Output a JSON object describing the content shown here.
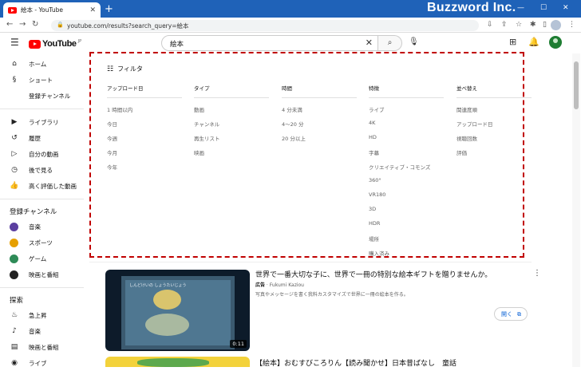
{
  "browser": {
    "tab_title": "絵本 - YouTube",
    "new_tab": "+",
    "brand": "Buzzword Inc.",
    "url": "youtube.com/results?search_query=絵本"
  },
  "header": {
    "logo_text": "YouTube",
    "logo_jp": "JP",
    "search_value": "絵本"
  },
  "sidebar": {
    "main": [
      {
        "label": "ホーム",
        "icon": "home-icon",
        "glyph": "⌂"
      },
      {
        "label": "ショート",
        "icon": "shorts-icon",
        "glyph": "§"
      },
      {
        "label": "登録チャンネル",
        "icon": "subscriptions-icon",
        "glyph": ""
      }
    ],
    "library": [
      {
        "label": "ライブラリ",
        "icon": "library-icon",
        "glyph": "▶"
      },
      {
        "label": "履歴",
        "icon": "history-icon",
        "glyph": "↺"
      },
      {
        "label": "自分の動画",
        "icon": "your-videos-icon",
        "glyph": "▷"
      },
      {
        "label": "後で見る",
        "icon": "watch-later-icon",
        "glyph": "◷"
      },
      {
        "label": "高く評価した動画",
        "icon": "liked-icon",
        "glyph": "👍"
      }
    ],
    "subscriptions_heading": "登録チャンネル",
    "channels": [
      {
        "label": "音楽",
        "color": "#5b3fa0"
      },
      {
        "label": "スポーツ",
        "color": "#e6a000"
      },
      {
        "label": "ゲーム",
        "color": "#2e8b57"
      },
      {
        "label": "映画と番組",
        "color": "#222222"
      }
    ],
    "explore_heading": "探索",
    "explore": [
      {
        "label": "急上昇",
        "icon": "trending-icon",
        "glyph": "♨"
      },
      {
        "label": "音楽",
        "icon": "music-icon",
        "glyph": "♪"
      },
      {
        "label": "映画と番組",
        "icon": "movies-icon",
        "glyph": "▤"
      },
      {
        "label": "ライブ",
        "icon": "live-icon",
        "glyph": "◉"
      }
    ]
  },
  "filter": {
    "title": "フィルタ",
    "columns": [
      {
        "heading": "アップロード日",
        "options": [
          "1 時間以内",
          "今日",
          "今週",
          "今月",
          "今年"
        ]
      },
      {
        "heading": "タイプ",
        "options": [
          "動画",
          "チャンネル",
          "再生リスト",
          "映画"
        ]
      },
      {
        "heading": "時間",
        "options": [
          "4 分未満",
          "4～20 分",
          "20 分以上"
        ]
      },
      {
        "heading": "特徴",
        "options": [
          "ライブ",
          "4K",
          "HD",
          "字幕",
          "クリエイティブ・コモンズ",
          "360°",
          "VR180",
          "3D",
          "HDR",
          "場所",
          "購入済み"
        ]
      },
      {
        "heading": "並べ替え",
        "options": [
          "関連度順",
          "アップロード日",
          "視聴回数",
          "評価"
        ]
      }
    ]
  },
  "results": {
    "video1": {
      "title": "世界で一番大切な子に、世界で一冊の特別な絵本ギフトを贈りませんか。",
      "ad_label": "広告",
      "advertiser": "Fukumi Kaziou",
      "description": "写真やメッセージを書く我料カスタマイズで世界に一冊の絵本を作る。",
      "duration": "0:11",
      "thumb_caption": "しんどけいの しょうたいじょう",
      "open_label": "開く"
    },
    "video2": {
      "title": "【絵本】おむすびころりん【読み聞かせ】日本昔ばなし　童話"
    }
  }
}
